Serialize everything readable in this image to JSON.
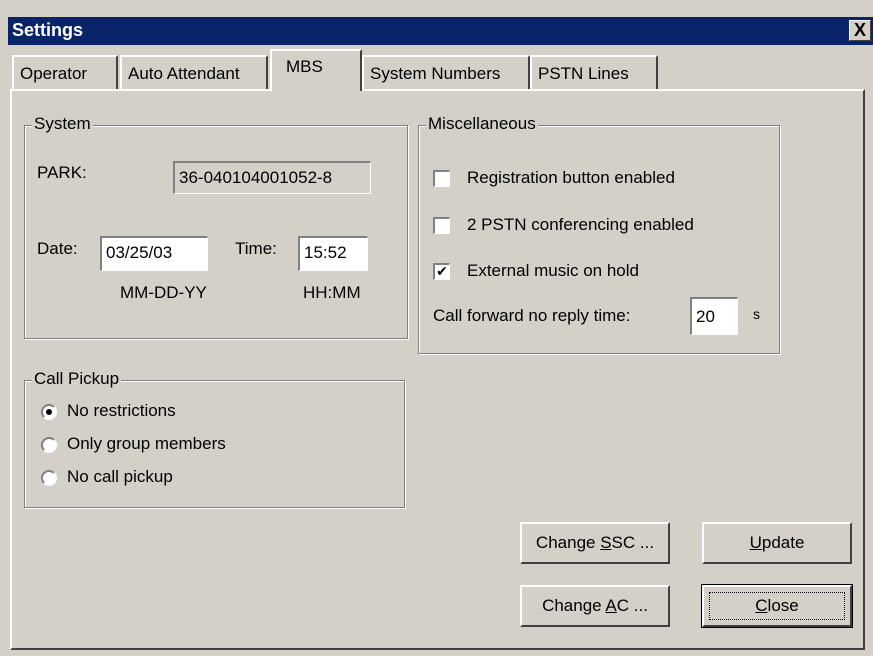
{
  "window": {
    "title": "Settings",
    "close_label": "X"
  },
  "tabs": [
    {
      "label": "Operator"
    },
    {
      "label": "Auto Attendant"
    },
    {
      "label": "MBS"
    },
    {
      "label": "System Numbers"
    },
    {
      "label": "PSTN Lines"
    }
  ],
  "system": {
    "title": "System",
    "park_label": "PARK:",
    "park_value": "36-040104001052-8",
    "date_label": "Date:",
    "date_value": "03/25/03",
    "date_hint": "MM-DD-YY",
    "time_label": "Time:",
    "time_value": "15:52",
    "time_hint": "HH:MM"
  },
  "misc": {
    "title": "Miscellaneous",
    "options": [
      {
        "label": "Registration button enabled",
        "checked": false
      },
      {
        "label": "2 PSTN conferencing enabled",
        "checked": false
      },
      {
        "label": "External music on hold",
        "checked": true
      }
    ],
    "forward_label": "Call forward no reply time:",
    "forward_value": "20",
    "forward_unit": "s"
  },
  "pickup": {
    "title": "Call Pickup",
    "options": [
      {
        "label": "No restrictions",
        "selected": true
      },
      {
        "label": "Only group members",
        "selected": false
      },
      {
        "label": "No call pickup",
        "selected": false
      }
    ]
  },
  "buttons": {
    "ssc": {
      "before": "Change ",
      "accel": "S",
      "after": "SC ..."
    },
    "update": {
      "before": "",
      "accel": "U",
      "after": "pdate"
    },
    "ac": {
      "before": "Change ",
      "accel": "A",
      "after": "C ..."
    },
    "close": {
      "before": "",
      "accel": "C",
      "after": "lose"
    }
  },
  "colors": {
    "face": "#d4d0c8",
    "titlebar": "#0a246a"
  }
}
